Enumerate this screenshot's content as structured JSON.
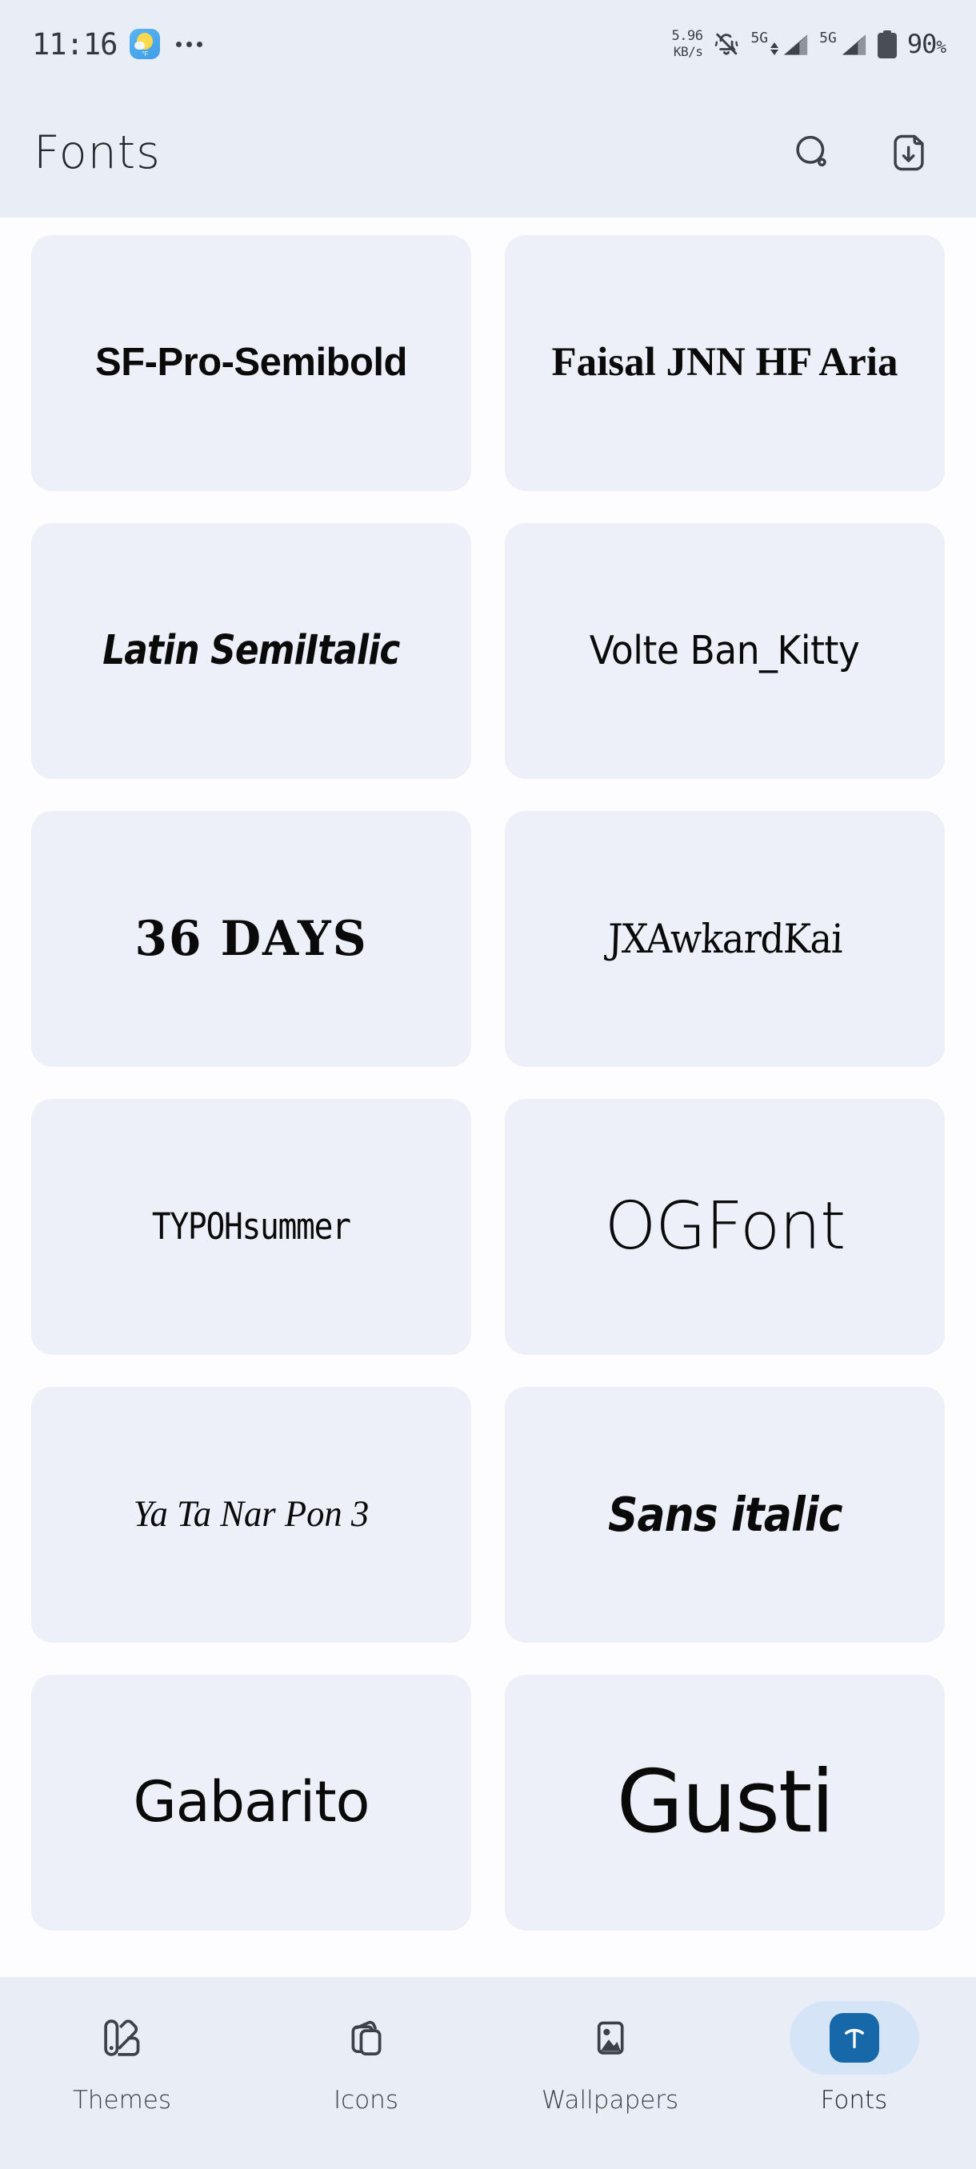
{
  "status_bar": {
    "time": "11:16",
    "weather_icon": "weather-sun-cloud-icon",
    "weather_unit": "°F",
    "overflow_icon": "more-dots-icon",
    "network_speed_value": "5.96",
    "network_speed_unit": "KB/s",
    "silent_icon": "bell-muted-icon",
    "sim1_network": "5G",
    "sim2_network": "5G",
    "battery_icon": "battery-full-icon",
    "battery_percent": "90",
    "battery_percent_symbol": "%"
  },
  "header": {
    "title": "Fonts",
    "search_icon": "search-icon",
    "download_icon": "file-download-icon"
  },
  "fonts": [
    {
      "name": "SF-Pro-Semibold",
      "style_class": "s-sfpro"
    },
    {
      "name": "Faisal JNN HF Aria",
      "style_class": "s-faisal"
    },
    {
      "name": "Latin SemiItalic",
      "style_class": "s-latin"
    },
    {
      "name": "Volte Ban_Kitty",
      "style_class": "s-volte"
    },
    {
      "name": "36 DAYS",
      "style_class": "s-36days"
    },
    {
      "name": "JXAwkardKai",
      "style_class": "s-jxak"
    },
    {
      "name": "TYPOHsummer",
      "style_class": "s-typoh"
    },
    {
      "name": "OGFont",
      "style_class": "s-ogfont"
    },
    {
      "name": "Ya Ta Nar Pon 3",
      "style_class": "s-yatanar"
    },
    {
      "name": "Sans italic",
      "style_class": "s-sansital"
    },
    {
      "name": "Gabarito",
      "style_class": "s-gabarito"
    },
    {
      "name": "Gusti",
      "style_class": "s-gusti"
    }
  ],
  "bottom_nav": {
    "items": [
      {
        "label": "Themes",
        "icon": "palette-swatch-icon",
        "active": false
      },
      {
        "label": "Icons",
        "icon": "stacked-cards-icon",
        "active": false
      },
      {
        "label": "Wallpapers",
        "icon": "image-picture-icon",
        "active": false
      },
      {
        "label": "Fonts",
        "icon": "text-t-icon",
        "active": true
      }
    ]
  },
  "colors": {
    "chrome_background": "#e9edf6",
    "page_background": "#fdfdff",
    "card_background": "#edf0f8",
    "active_pill": "#d6e4f8",
    "accent_blue": "#1668a8",
    "text_primary": "#23262c",
    "icon_stroke": "#3c4049"
  }
}
